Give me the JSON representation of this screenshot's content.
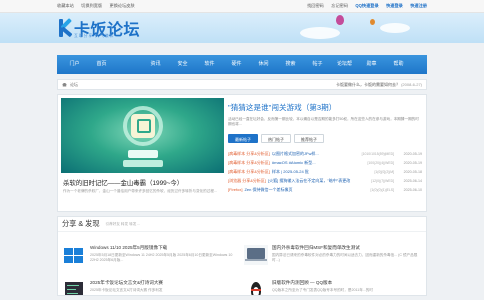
{
  "topbar": {
    "left": [
      "收藏本站",
      "切换到宽版",
      "更换论坛皮肤"
    ],
    "right": [
      {
        "label": "找回密码",
        "blue": false
      },
      {
        "label": "忘记密码",
        "blue": false
      },
      {
        "label": "QQ快速登录",
        "blue": true
      },
      {
        "label": "快速登录",
        "blue": true
      },
      {
        "label": "快速注册",
        "blue": true
      }
    ]
  },
  "logo": {
    "text": "卡饭论坛",
    "tagline": "互助分享  大气谦和"
  },
  "nav": {
    "items": [
      "门户",
      "首页",
      "",
      "资讯",
      "安全",
      "软件",
      "硬件",
      "休闲",
      "搜索",
      "帖子",
      "论坛帮",
      "勋章",
      "帮助"
    ],
    "active_index": 2
  },
  "crumb": {
    "current": "论坛",
    "notice_prefix": "卡饭要做什么，卡饭的需要如何去？",
    "notice_date": "(2008-6-27)"
  },
  "slide": {
    "title": "杀软的旧时记忆——金山毒霸（1999~今）",
    "desc": "作为一个老牌的杀软厂，金山一个曾给用户带来许多回忆的杀软，经历过许多转折与变化的过程..."
  },
  "feature": {
    "title": "\"猜猜这是谁\"闯关游戏（第3期）",
    "intro": "活动已经一直在坛好会，反而第一期比较，本以确自以是否期的能多打50权，所在这些人的在参与游戏，本期猜一期的时期也将...",
    "buttons": [
      "最新帖子",
      "热门帖子",
      "推荐帖子"
    ],
    "news": [
      {
        "tag": "[病毒样本 分享&分析区]",
        "title": "以图片格式加密的JFw样...",
        "meta": "[1010/1015(59)|MED]",
        "date": "2020-05-19"
      },
      {
        "tag": "[病毒样本 分享&分析区]",
        "title": "#macOS #Atomic 新型...",
        "meta": "[100(20)(4)|WED]",
        "date": "2020-05-19"
      },
      {
        "tag": "[病毒样本 分享&分析区]",
        "title": "样本 | 2025-05-24 批",
        "meta": "[1(0)[0](2)|M]",
        "date": "2020-05-18"
      },
      {
        "tag": "[浏览器 分享&分析区]",
        "title": "[火狐] 搜狗输入法云在不定向某，\"暗中\"表更改",
        "meta": "[12(0)(7)|WED]",
        "date": "2025-06-14"
      },
      {
        "tag": "[Firefox]",
        "title": "Zen 保持微信一个差标像页",
        "meta": "[1(0)(0)(1)|ELS]",
        "date": "2025-06-10"
      }
    ]
  },
  "share": {
    "title": "分享 & 发现",
    "tabs": "引荐好友 转发 转发 ...",
    "items": [
      {
        "icon": "windows-icon",
        "name": "Windows 11/10 2025年5月版镜像下载",
        "desc": "2025年5月18日更新至Windows 11 24H2 2025年5月版 2025年6月10日更新至Windows 10 22H2 2025年6月版..."
      },
      {
        "icon": "laptop-icon",
        "name": "国内外杀毒软件回归MSF和复而单改生测试",
        "desc": "国内算法已请来的杀毒软件对必的杀毒力的时间以适去力，因而重新的杀毒信... (C 镜产品限时...)"
      },
      {
        "icon": "code-icon",
        "name": "2025年卡饭论坛文言文&打诗词大赛",
        "desc": "2025年卡饭论坛文言文&打诗词大赛 作多利发 "
      },
      {
        "icon": "penguin-icon",
        "name": "旧版软件内测回顾 — QQ版本",
        "desc": "QQ版本之所至为了专门发表QQ版号本号的时，是2011年...的时"
      }
    ]
  }
}
